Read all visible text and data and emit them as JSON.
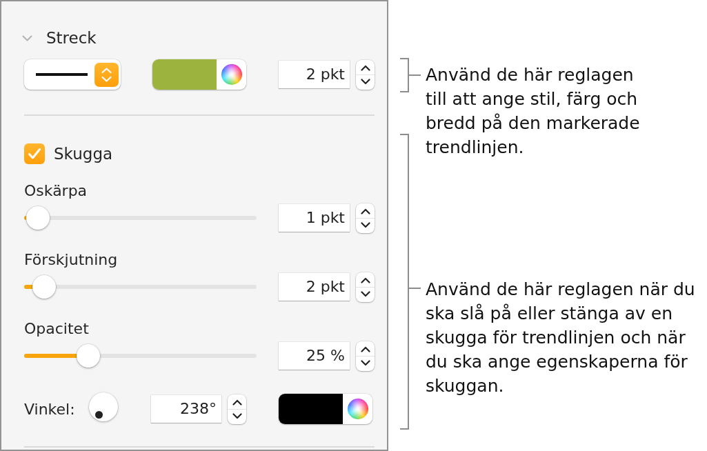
{
  "panel": {
    "stroke": {
      "title": "Streck",
      "expanded": true,
      "color": "#9cb43e",
      "value": "2 pkt"
    },
    "shadow": {
      "label": "Skugga",
      "checked": true,
      "sliders": [
        {
          "label": "Oskärpa",
          "level": 0.01,
          "value": "1 pkt"
        },
        {
          "label": "Förskjutning",
          "level": 0.04,
          "value": "2 pkt"
        },
        {
          "label": "Opacitet",
          "level": 0.25,
          "value": "25 %"
        }
      ],
      "angle": {
        "label": "Vinkel:",
        "value": "238°"
      },
      "color": "#000000"
    }
  },
  "callouts": [
    {
      "text": "Använd de här reglagen till att ange stil, färg och bredd på den markerade trendlinjen."
    },
    {
      "text": "Använd de här reglagen när du ska slå på eller stänga av en skugga för trendlinjen och när du ska ange egenskaperna för skuggan."
    }
  ]
}
